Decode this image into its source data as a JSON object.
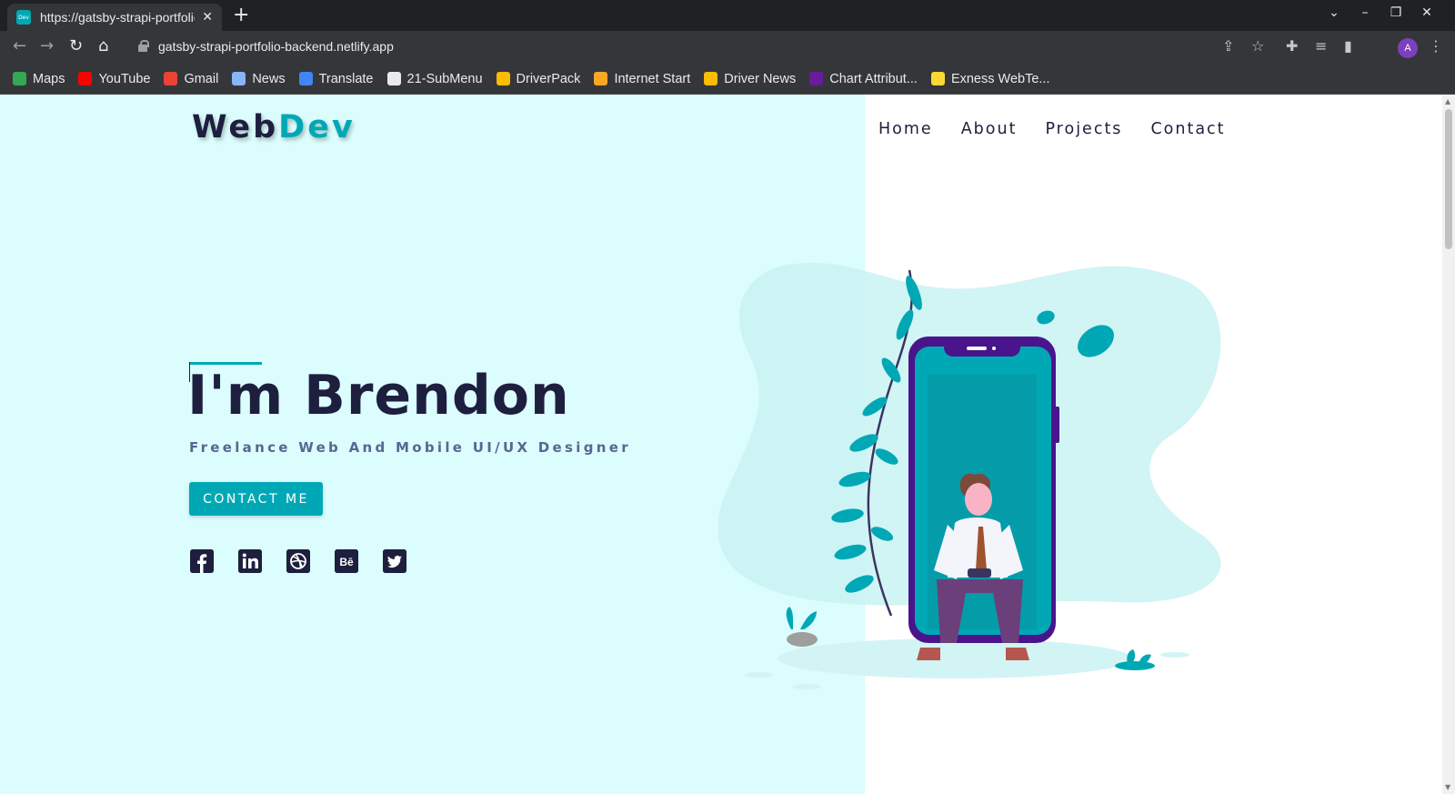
{
  "browser": {
    "tab_title": "https://gatsby-strapi-portfolio-backend.netlify.app",
    "favicon_text": "Dev",
    "url": "gatsby-strapi-portfolio-backend.netlify.app",
    "profile_initial": "A",
    "bookmarks": [
      {
        "label": "Maps",
        "icon": "maps-icon",
        "color": "#34a853"
      },
      {
        "label": "YouTube",
        "icon": "youtube-icon",
        "color": "#ff0000"
      },
      {
        "label": "Gmail",
        "icon": "gmail-icon",
        "color": "#ea4335"
      },
      {
        "label": "News",
        "icon": "news-icon",
        "color": "#8ab4f8"
      },
      {
        "label": "Translate",
        "icon": "translate-icon",
        "color": "#4285f4"
      },
      {
        "label": "21-SubMenu",
        "icon": "globe-icon",
        "color": "#e8eaed"
      },
      {
        "label": "DriverPack",
        "icon": "driverpack-icon",
        "color": "#fbbc04"
      },
      {
        "label": "Internet Start",
        "icon": "internet-start-icon",
        "color": "#f9a825"
      },
      {
        "label": "Driver News",
        "icon": "driver-news-icon",
        "color": "#fbbc04"
      },
      {
        "label": "Chart Attribut...",
        "icon": "chart-attribution-icon",
        "color": "#6a1b9a"
      },
      {
        "label": "Exness WebTe...",
        "icon": "exness-icon",
        "color": "#fdd835"
      }
    ]
  },
  "site": {
    "logo_part1": "Web",
    "logo_part2": "Dev",
    "nav": [
      "Home",
      "About",
      "Projects",
      "Contact"
    ],
    "hero_title": "I'm Brendon",
    "hero_subtitle": "Freelance Web And Mobile UI/UX Designer",
    "cta_label": "CONTACT ME",
    "socials": [
      {
        "name": "facebook-icon",
        "glyph": "f"
      },
      {
        "name": "linkedin-icon",
        "glyph": "in"
      },
      {
        "name": "dribbble-icon",
        "glyph": "◎"
      },
      {
        "name": "behance-icon",
        "glyph": "Bē"
      },
      {
        "name": "twitter-icon",
        "glyph": "🐦"
      }
    ],
    "colors": {
      "accent": "#00a8b5",
      "dark": "#1e1e3f",
      "left_bg": "#dbfdfd",
      "subtitle": "#5a6690"
    }
  }
}
